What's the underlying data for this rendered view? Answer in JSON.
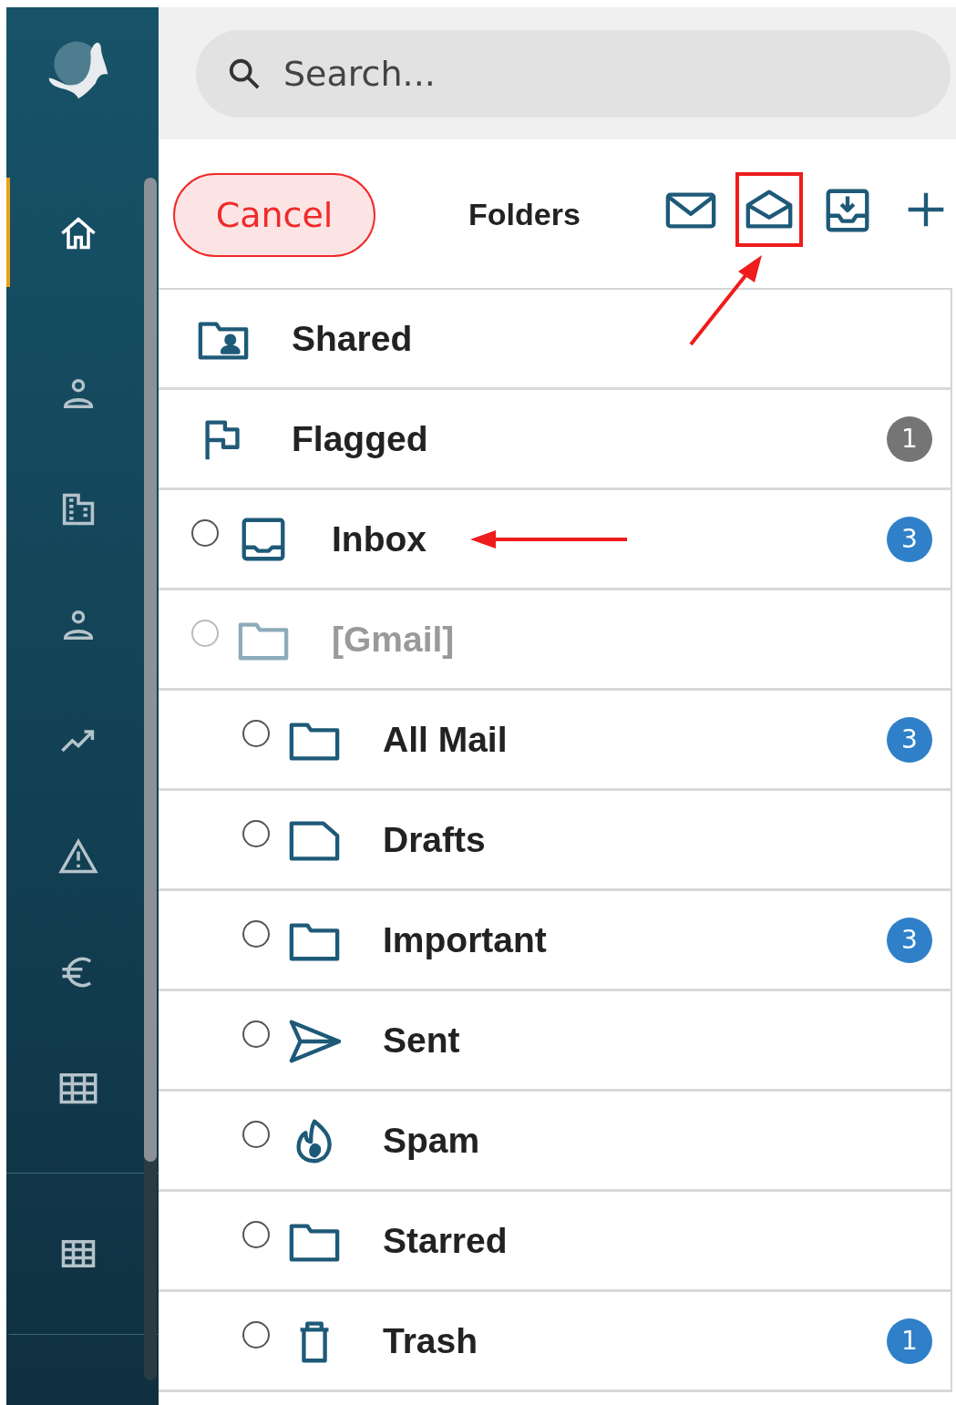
{
  "search": {
    "placeholder": "Search..."
  },
  "sidebar": {
    "items": [
      {
        "kind": "home",
        "selected": true
      },
      {
        "kind": "person",
        "selected": false
      },
      {
        "kind": "building",
        "selected": false
      },
      {
        "kind": "person",
        "selected": false
      },
      {
        "kind": "chart",
        "selected": false
      },
      {
        "kind": "warning",
        "selected": false
      },
      {
        "kind": "euro",
        "selected": false
      },
      {
        "kind": "table",
        "selected": false
      }
    ],
    "bottom_items": [
      {
        "kind": "grid",
        "selected": false
      }
    ]
  },
  "header": {
    "cancel": "Cancel",
    "title": "Folders",
    "tools": [
      {
        "kind": "mail",
        "highlighted": false
      },
      {
        "kind": "mail-open",
        "highlighted": true
      },
      {
        "kind": "download",
        "highlighted": false
      },
      {
        "kind": "plus",
        "highlighted": false
      }
    ]
  },
  "folders": [
    {
      "kind": "shared",
      "label": "Shared"
    },
    {
      "kind": "flag",
      "label": "Flagged",
      "count": "1",
      "color": "#757575"
    },
    {
      "kind": "inbox",
      "label": "Inbox",
      "count": "3",
      "color": "#2f80c8",
      "selected": false,
      "annotated": true
    },
    {
      "kind": "folder",
      "label": "[Gmail]",
      "selected": false,
      "disabled": true,
      "children": [
        {
          "kind": "folder",
          "label": "All Mail",
          "count": "3",
          "color": "#2f80c8",
          "selected": false
        },
        {
          "kind": "draft",
          "label": "Drafts",
          "selected": false
        },
        {
          "kind": "folder",
          "label": "Important",
          "count": "3",
          "color": "#2f80c8",
          "selected": false
        },
        {
          "kind": "send",
          "label": "Sent",
          "selected": false
        },
        {
          "kind": "fire",
          "label": "Spam",
          "selected": false
        },
        {
          "kind": "folder",
          "label": "Starred",
          "selected": false
        },
        {
          "kind": "trash",
          "label": "Trash",
          "count": "1",
          "color": "#2f80c8",
          "selected": false
        }
      ]
    }
  ]
}
